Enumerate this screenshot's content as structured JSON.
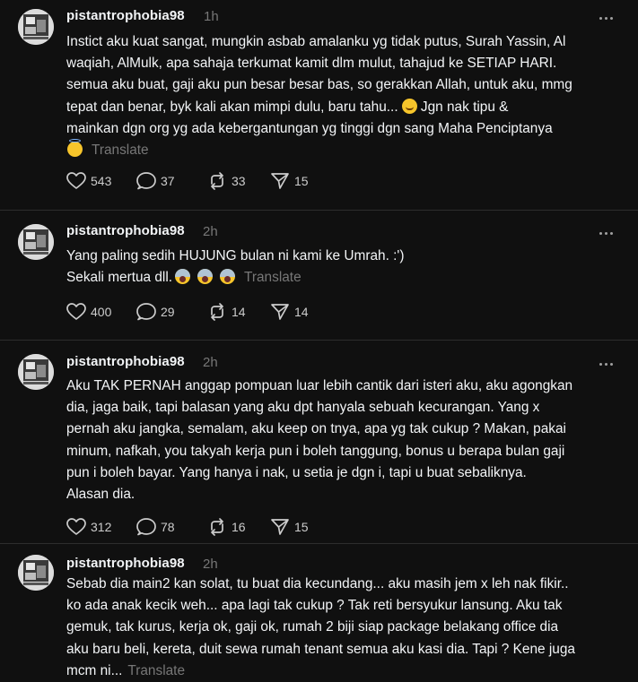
{
  "posts": [
    {
      "username": "pistantrophobia98",
      "time": "1h",
      "lines": [
        "Instict aku kuat sangat, mungkin asbab amalanku yg tidak putus, Surah Yassin, Al",
        "waqiah, AlMulk, apa sahaja terkumat kamit dlm mulut, tahajud ke SETIAP HARI.",
        "semua aku buat, gaji aku pun besar besar bas, so gerakkan Allah, untuk aku, mmg",
        "tepat dan benar, byk kali akan mimpi dulu, baru tahu...",
        "mainkan dgn org yg ada kebergantungan yg tinggi dgn sang Maha Penciptanya"
      ],
      "line4_tail": "Jgn nak tipu &",
      "emoji_smile": "smiling-face-emoji",
      "emoji_halo": "halo-face-emoji",
      "translate": "Translate",
      "likes": "543",
      "replies": "37",
      "reposts": "33",
      "shares": "15"
    },
    {
      "username": "pistantrophobia98",
      "time": "2h",
      "lines": [
        "Yang paling sedih HUJUNG bulan ni kami ke Umrah. :')",
        "Sekali mertua dll."
      ],
      "emoji_cry": "screaming-face-emoji",
      "translate": "Translate",
      "likes": "400",
      "replies": "29",
      "reposts": "14",
      "shares": "14"
    },
    {
      "username": "pistantrophobia98",
      "time": "2h",
      "lines": [
        "Aku TAK PERNAH anggap pompuan luar lebih cantik dari isteri aku, aku agongkan",
        "dia, jaga baik, tapi balasan yang aku dpt hanyala sebuah kecurangan. Yang x",
        "pernah aku jangka, semalam, aku keep on tnya, apa yg tak cukup ? Makan, pakai",
        "minum, nafkah, you takyah kerja pun i boleh tanggung, bonus u berapa bulan gaji",
        "pun i boleh bayar. Yang hanya i nak, u setia je dgn i, tapi u buat sebaliknya.",
        "Alasan dia."
      ],
      "likes": "312",
      "replies": "78",
      "reposts": "16",
      "shares": "15"
    },
    {
      "username": "pistantrophobia98",
      "time": "2h",
      "lines": [
        "Sebab dia main2 kan solat, tu buat dia kecundang... aku masih jem x leh nak fikir..",
        "ko ada anak kecik weh... apa lagi tak cukup ? Tak reti bersyukur lansung. Aku tak",
        "gemuk, tak kurus, kerja ok, gaji ok, rumah 2 biji siap package belakang office dia",
        "aku baru beli, kereta, duit sewa rumah tenant semua aku kasi dia. Tapi ? Kene juga",
        "mcm ni..."
      ],
      "translate": "Translate"
    }
  ],
  "colors": {
    "background": "#101010",
    "text": "#f3f5f7",
    "muted": "#777777",
    "separator": "#2d2d2d"
  },
  "icons": {
    "like": "heart-icon",
    "reply": "comment-bubble-icon",
    "repost": "repost-arrows-icon",
    "share": "paper-plane-icon",
    "more": "more-dots-icon"
  }
}
